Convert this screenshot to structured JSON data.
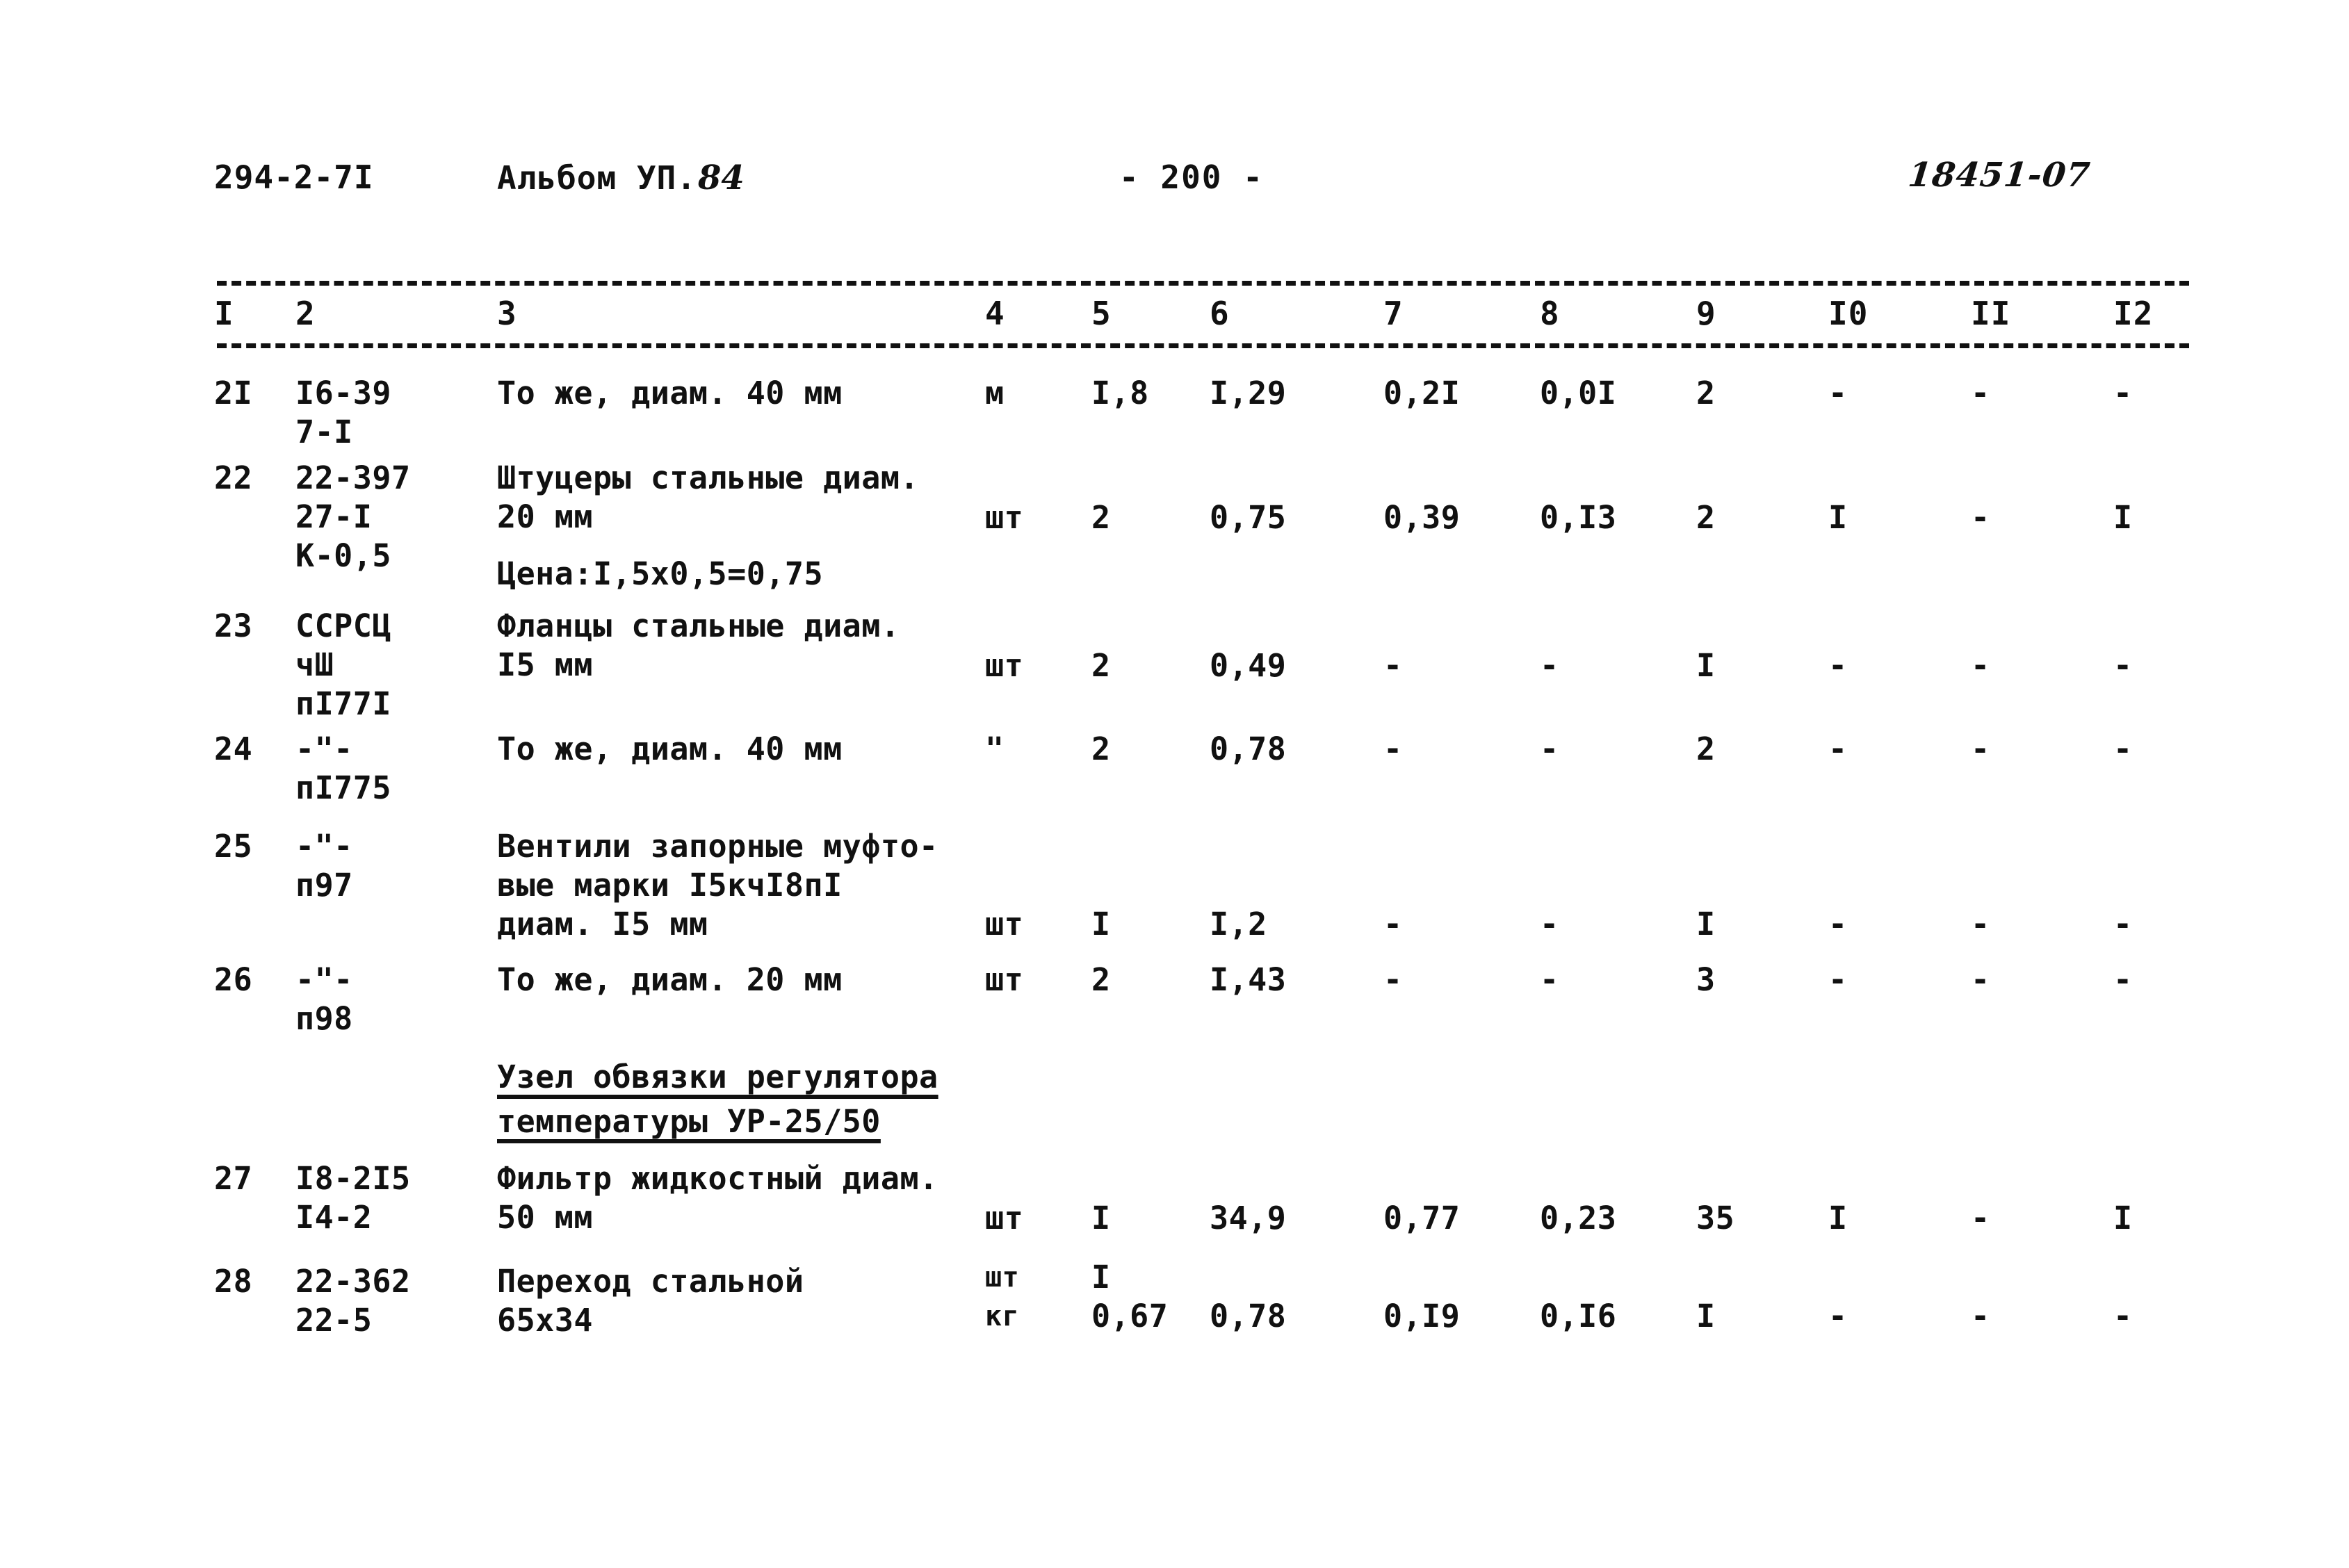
{
  "header": {
    "doc_code": "294-2-7I",
    "album_label": "Альбом УП.",
    "album_number": "84",
    "page_marker": "- 200 -",
    "reference_number": "18451-07"
  },
  "table": {
    "column_headers": [
      "I",
      "2",
      "3",
      "4",
      "5",
      "6",
      "7",
      "8",
      "9",
      "I0",
      "II",
      "I2"
    ],
    "rows": [
      {
        "num": "2I",
        "code_line1": "I6-39",
        "code_line2": "7-I",
        "code_line3": "",
        "name_line1": "То же, диам. 40 мм",
        "name_line2": "",
        "name_line3": "",
        "note": "",
        "unit": "м",
        "unit2": "",
        "v5": "I,8",
        "v5b": "",
        "v6": "I,29",
        "v7": "0,2I",
        "v8": "0,0I",
        "v9": "2",
        "v10": "-",
        "v11": "-",
        "v12": "-"
      },
      {
        "num": "22",
        "code_line1": "22-397",
        "code_line2": "27-I",
        "code_line3": "К-0,5",
        "name_line1": "Штуцеры стальные диам.",
        "name_line2": "20 мм",
        "name_line3": "",
        "note": "Цена:I,5х0,5=0,75",
        "unit": "шт",
        "unit2": "",
        "v5": "2",
        "v5b": "",
        "v6": "0,75",
        "v7": "0,39",
        "v8": "0,I3",
        "v9": "2",
        "v10": "I",
        "v11": "-",
        "v12": "I"
      },
      {
        "num": "23",
        "code_line1": "ССРСЦ",
        "code_line2": "чШ",
        "code_line3": "пI77I",
        "name_line1": "Фланцы стальные диам.",
        "name_line2": "I5 мм",
        "name_line3": "",
        "note": "",
        "unit": "шт",
        "unit2": "",
        "v5": "2",
        "v5b": "",
        "v6": "0,49",
        "v7": "-",
        "v8": "-",
        "v9": "I",
        "v10": "-",
        "v11": "-",
        "v12": "-"
      },
      {
        "num": "24",
        "code_line1": "-\"-",
        "code_line2": "пI775",
        "code_line3": "",
        "name_line1": "То же, диам. 40 мм",
        "name_line2": "",
        "name_line3": "",
        "note": "",
        "unit": "\"",
        "unit2": "",
        "v5": "2",
        "v5b": "",
        "v6": "0,78",
        "v7": "-",
        "v8": "-",
        "v9": "2",
        "v10": "-",
        "v11": "-",
        "v12": "-"
      },
      {
        "num": "25",
        "code_line1": "-\"-",
        "code_line2": "п97",
        "code_line3": "",
        "name_line1": "Вентили запорные муфто-",
        "name_line2": "вые марки I5кчI8пI",
        "name_line3": "диам. I5 мм",
        "note": "",
        "unit": "шт",
        "unit2": "",
        "v5": "I",
        "v5b": "",
        "v6": "I,2",
        "v7": "-",
        "v8": "-",
        "v9": "I",
        "v10": "-",
        "v11": "-",
        "v12": "-"
      },
      {
        "num": "26",
        "code_line1": "-\"-",
        "code_line2": "п98",
        "code_line3": "",
        "name_line1": "То же, диам. 20 мм",
        "name_line2": "",
        "name_line3": "",
        "note": "",
        "unit": "шт",
        "unit2": "",
        "v5": "2",
        "v5b": "",
        "v6": "I,43",
        "v7": "-",
        "v8": "-",
        "v9": "3",
        "v10": "-",
        "v11": "-",
        "v12": "-"
      },
      {
        "num": "27",
        "code_line1": "I8-2I5",
        "code_line2": "I4-2",
        "code_line3": "",
        "name_line1": "Фильтр жидкостный диам.",
        "name_line2": "50 мм",
        "name_line3": "",
        "note": "",
        "unit": "шт",
        "unit2": "",
        "v5": "I",
        "v5b": "",
        "v6": "34,9",
        "v7": "0,77",
        "v8": "0,23",
        "v9": "35",
        "v10": "I",
        "v11": "-",
        "v12": "I"
      },
      {
        "num": "28",
        "code_line1": "22-362",
        "code_line2": "22-5",
        "code_line3": "",
        "name_line1": "Переход стальной",
        "name_line2": "65х34",
        "name_line3": "",
        "note": "",
        "unit": "шт",
        "unit2": "кг",
        "v5": "I",
        "v5b": "0,67",
        "v6": "0,78",
        "v7": "0,I9",
        "v8": "0,I6",
        "v9": "I",
        "v10": "-",
        "v11": "-",
        "v12": "-"
      }
    ],
    "section_heading": {
      "line1": "Узел обвязки регулятора",
      "line2": "температуры УР-25/50"
    }
  }
}
